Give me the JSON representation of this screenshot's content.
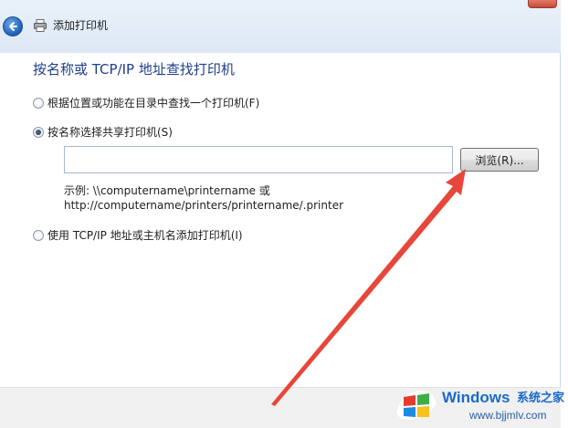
{
  "window": {
    "title": "添加打印机"
  },
  "main": {
    "heading": "按名称或 TCP/IP 地址查找打印机",
    "options": [
      {
        "label": "根据位置或功能在目录中查找一个打印机(F)",
        "selected": false
      },
      {
        "label": "按名称选择共享打印机(S)",
        "selected": true
      },
      {
        "label": "使用 TCP/IP 地址或主机名添加打印机(I)",
        "selected": false
      }
    ],
    "shared_printer_input": {
      "value": "",
      "placeholder": ""
    },
    "browse_label": "浏览(R)...",
    "example_line1": "示例: \\\\computername\\printername 或",
    "example_line2": "http://computername/printers/printername/.printer"
  },
  "watermark": {
    "brand": "Windows",
    "site": "系统之家",
    "url": "www.bjjmlv.com"
  },
  "colors": {
    "heading": "#1f3f8a",
    "arrow": "#e8463a",
    "watermark": "#1b6ac9"
  },
  "icons": [
    "back-arrow-icon",
    "printer-icon",
    "windows-logo-icon"
  ]
}
